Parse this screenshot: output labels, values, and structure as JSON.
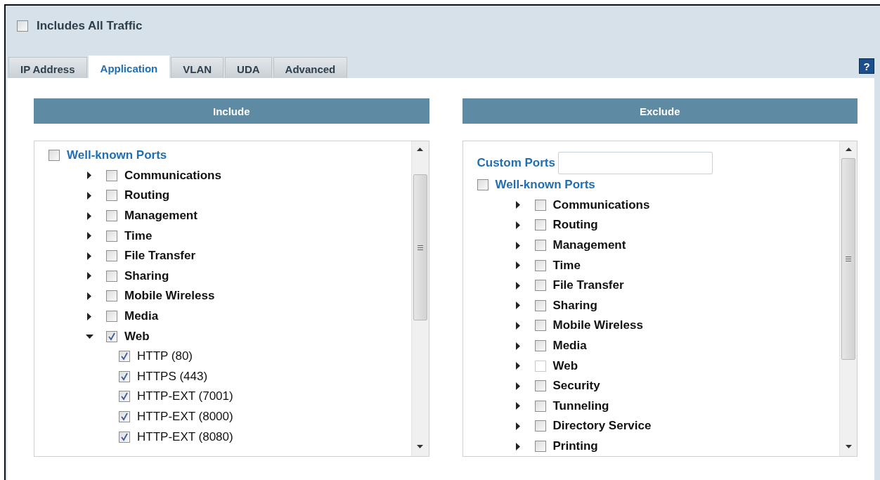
{
  "includes_all_traffic": {
    "label": "Includes All Traffic",
    "checked": false
  },
  "help_button": {
    "label": "?"
  },
  "tabs": [
    {
      "label": "IP Address",
      "selected": false
    },
    {
      "label": "Application",
      "selected": true
    },
    {
      "label": "VLAN",
      "selected": false
    },
    {
      "label": "UDA",
      "selected": false
    },
    {
      "label": "Advanced",
      "selected": false
    }
  ],
  "panels": [
    {
      "title": "Include",
      "tree": [
        {
          "label": "Well-known Ports",
          "checked": false,
          "children": [
            {
              "label": "Communications",
              "checked": false,
              "expanded": false
            },
            {
              "label": "Routing",
              "checked": false,
              "expanded": false
            },
            {
              "label": "Management",
              "checked": false,
              "expanded": false
            },
            {
              "label": "Time",
              "checked": false,
              "expanded": false
            },
            {
              "label": "File Transfer",
              "checked": false,
              "expanded": false
            },
            {
              "label": "Sharing",
              "checked": false,
              "expanded": false
            },
            {
              "label": "Mobile Wireless",
              "checked": false,
              "expanded": false
            },
            {
              "label": "Media",
              "checked": false,
              "expanded": false
            },
            {
              "label": "Web",
              "checked": true,
              "expanded": true,
              "children": [
                {
                  "label": "HTTP (80)",
                  "checked": true
                },
                {
                  "label": "HTTPS (443)",
                  "checked": true
                },
                {
                  "label": "HTTP-EXT (7001)",
                  "checked": true
                },
                {
                  "label": "HTTP-EXT (8000)",
                  "checked": true
                },
                {
                  "label": "HTTP-EXT (8080)",
                  "checked": true
                }
              ]
            }
          ]
        }
      ]
    },
    {
      "title": "Exclude",
      "custom_ports": {
        "label": "Custom Ports"
      },
      "tree": [
        {
          "label": "Well-known Ports",
          "checked": false,
          "children": [
            {
              "label": "Communications",
              "checked": false,
              "expanded": false
            },
            {
              "label": "Routing",
              "checked": false,
              "expanded": false
            },
            {
              "label": "Management",
              "checked": false,
              "expanded": false
            },
            {
              "label": "Time",
              "checked": false,
              "expanded": false
            },
            {
              "label": "File Transfer",
              "checked": false,
              "expanded": false
            },
            {
              "label": "Sharing",
              "checked": false,
              "expanded": false
            },
            {
              "label": "Mobile Wireless",
              "checked": false,
              "expanded": false
            },
            {
              "label": "Media",
              "checked": false,
              "expanded": false
            },
            {
              "label": "Web",
              "checked": false,
              "expanded": false,
              "disabled": true
            },
            {
              "label": "Security",
              "checked": false,
              "expanded": false
            },
            {
              "label": "Tunneling",
              "checked": false,
              "expanded": false
            },
            {
              "label": "Directory Service",
              "checked": false,
              "expanded": false
            },
            {
              "label": "Printing",
              "checked": false,
              "expanded": false
            }
          ]
        }
      ]
    }
  ]
}
